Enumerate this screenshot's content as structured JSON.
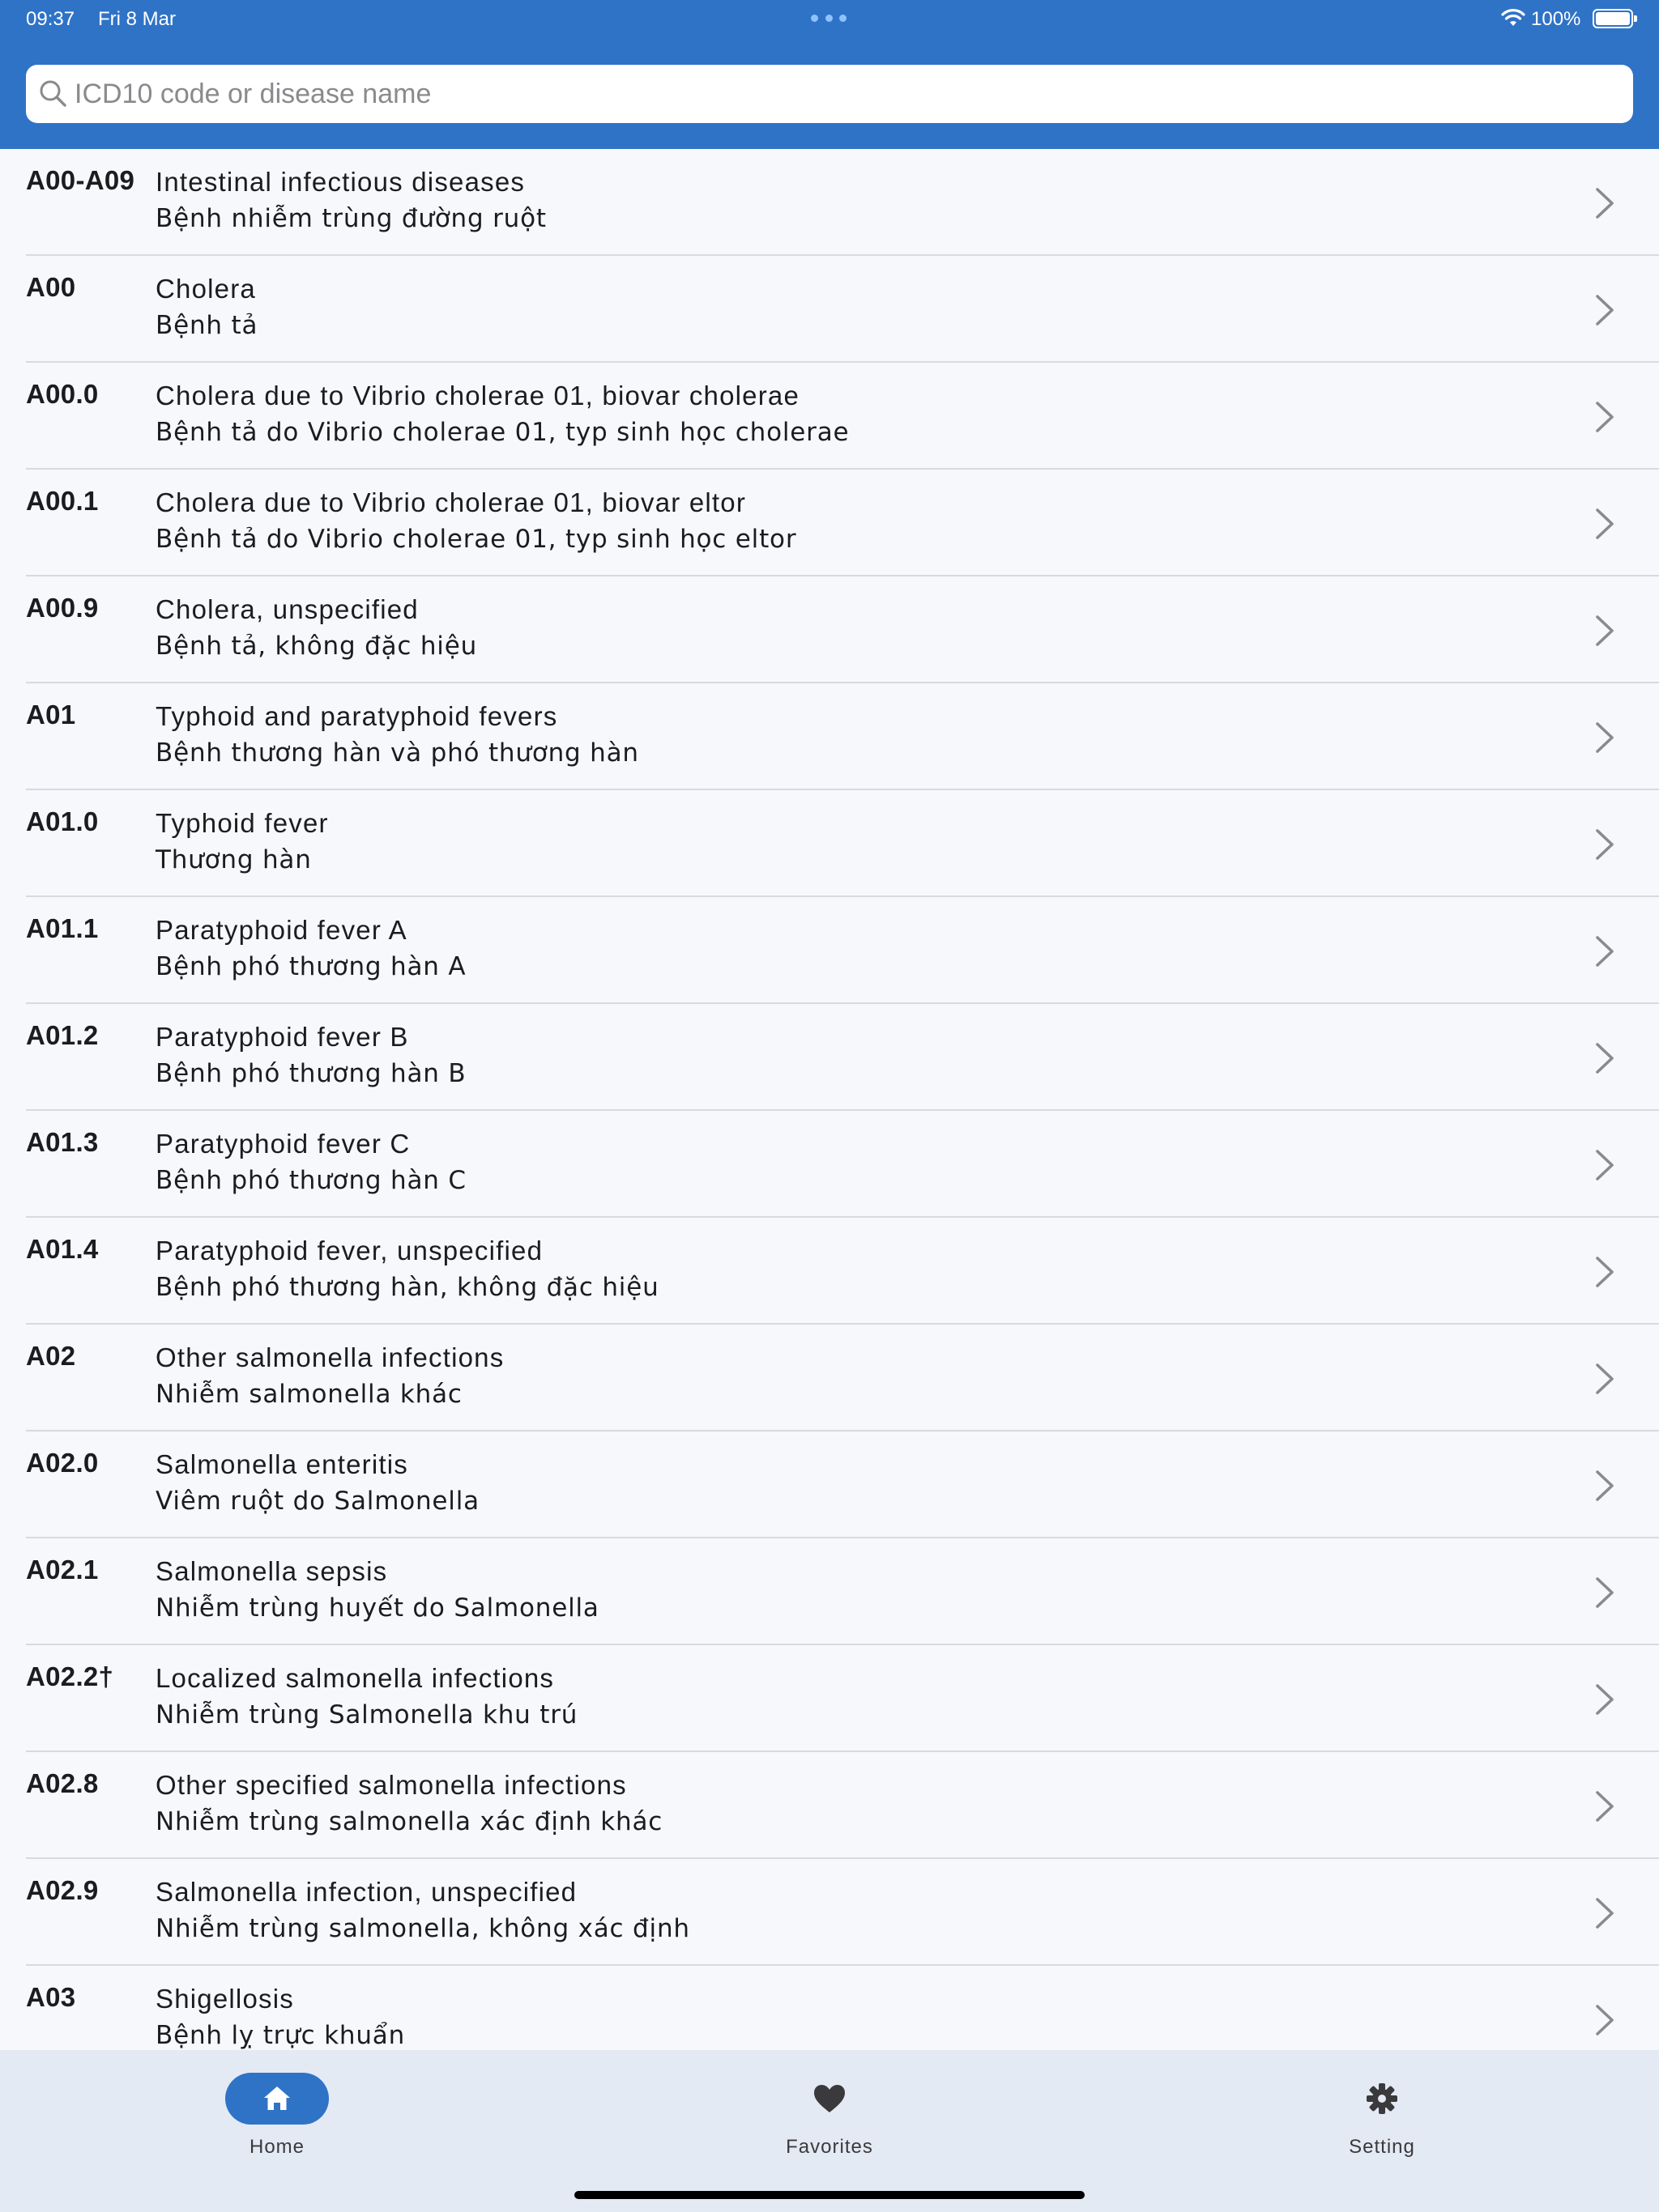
{
  "status_bar": {
    "time": "09:37",
    "date": "Fri 8 Mar",
    "battery": "100%"
  },
  "search": {
    "placeholder": "ICD10 code or disease name",
    "value": ""
  },
  "colors": {
    "header": "#2f73c7",
    "list_background": "#f6f8fc",
    "tab_bar": "#e4eaf4",
    "active_tab": "#2f73c7"
  },
  "list": [
    {
      "code": "A00-A09",
      "en": "Intestinal infectious diseases",
      "vi": "Bệnh nhiễm trùng đường ruột"
    },
    {
      "code": "A00",
      "en": "Cholera",
      "vi": "Bệnh tả"
    },
    {
      "code": "A00.0",
      "en": "Cholera due to Vibrio cholerae 01, biovar cholerae",
      "vi": "Bệnh tả do Vibrio cholerae 01, typ sinh học cholerae"
    },
    {
      "code": "A00.1",
      "en": "Cholera due to Vibrio cholerae 01, biovar eltor",
      "vi": "Bệnh tả do Vibrio cholerae 01, typ sinh học eltor"
    },
    {
      "code": "A00.9",
      "en": "Cholera, unspecified",
      "vi": "Bệnh tả, không đặc hiệu"
    },
    {
      "code": "A01",
      "en": "Typhoid and paratyphoid fevers",
      "vi": "Bệnh thương hàn và phó thương hàn"
    },
    {
      "code": "A01.0",
      "en": "Typhoid fever",
      "vi": "Thương hàn"
    },
    {
      "code": "A01.1",
      "en": "Paratyphoid fever A",
      "vi": "Bệnh phó thương hàn A"
    },
    {
      "code": "A01.2",
      "en": "Paratyphoid fever B",
      "vi": "Bệnh phó thương hàn B"
    },
    {
      "code": "A01.3",
      "en": "Paratyphoid fever C",
      "vi": "Bệnh phó thương hàn C"
    },
    {
      "code": "A01.4",
      "en": "Paratyphoid fever, unspecified",
      "vi": "Bệnh phó thương hàn, không đặc hiệu"
    },
    {
      "code": "A02",
      "en": "Other salmonella infections",
      "vi": "Nhiễm salmonella khác"
    },
    {
      "code": "A02.0",
      "en": " Salmonella enteritis",
      "vi": "Viêm ruột do Salmonella"
    },
    {
      "code": "A02.1",
      "en": "Salmonella sepsis",
      "vi": "Nhiễm trùng huyết do Salmonella"
    },
    {
      "code": "A02.2†",
      "en": "Localized salmonella infections",
      "vi": "Nhiễm trùng Salmonella khu trú"
    },
    {
      "code": "A02.8",
      "en": "Other specified salmonella infections",
      "vi": "Nhiễm trùng salmonella xác định khác"
    },
    {
      "code": "A02.9",
      "en": "Salmonella infection, unspecified",
      "vi": "Nhiễm trùng salmonella, không xác định"
    },
    {
      "code": "A03",
      "en": "Shigellosis",
      "vi": "Bệnh lỵ trực khuẩn"
    }
  ],
  "tabs": [
    {
      "label": "Home",
      "icon": "home-icon",
      "active": true
    },
    {
      "label": "Favorites",
      "icon": "heart-icon",
      "active": false
    },
    {
      "label": "Setting",
      "icon": "gear-icon",
      "active": false
    }
  ]
}
